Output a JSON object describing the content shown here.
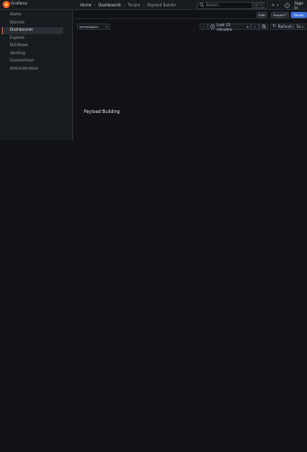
{
  "app": {
    "name": "Grafana"
  },
  "breadcrumbs": [
    "Home",
    "Dashboards",
    "Tenjiro",
    "Payload Builder"
  ],
  "search": {
    "placeholder": "Search...",
    "shortcut": "ctrl+k"
  },
  "header": {
    "add_icon": "plus-icon",
    "help_icon": "help-icon",
    "sign_in": "Sign in"
  },
  "toolbar": {
    "edit_label": "Edit",
    "export_label": "Export",
    "share_label": "Share"
  },
  "sidebar": {
    "items": [
      {
        "label": "Home",
        "active": false
      },
      {
        "label": "Starred",
        "active": false
      },
      {
        "label": "Dashboards",
        "active": true
      },
      {
        "label": "Explore",
        "active": false
      },
      {
        "label": "Drilldown",
        "active": false
      },
      {
        "label": "Alerting",
        "active": false
      },
      {
        "label": "Connections",
        "active": false
      },
      {
        "label": "Administration",
        "active": false
      }
    ]
  },
  "variables": {
    "namespace_label": "namespace"
  },
  "time": {
    "range_label": "Last 15 minutes",
    "refresh_label": "Refresh",
    "refresh_interval": "5s"
  },
  "panel": {
    "title": "Payload Building"
  },
  "colors": {
    "accent": "#f05a28",
    "primary": "#3d71d9",
    "background": "#111217",
    "sidebar": "#181b1f"
  }
}
